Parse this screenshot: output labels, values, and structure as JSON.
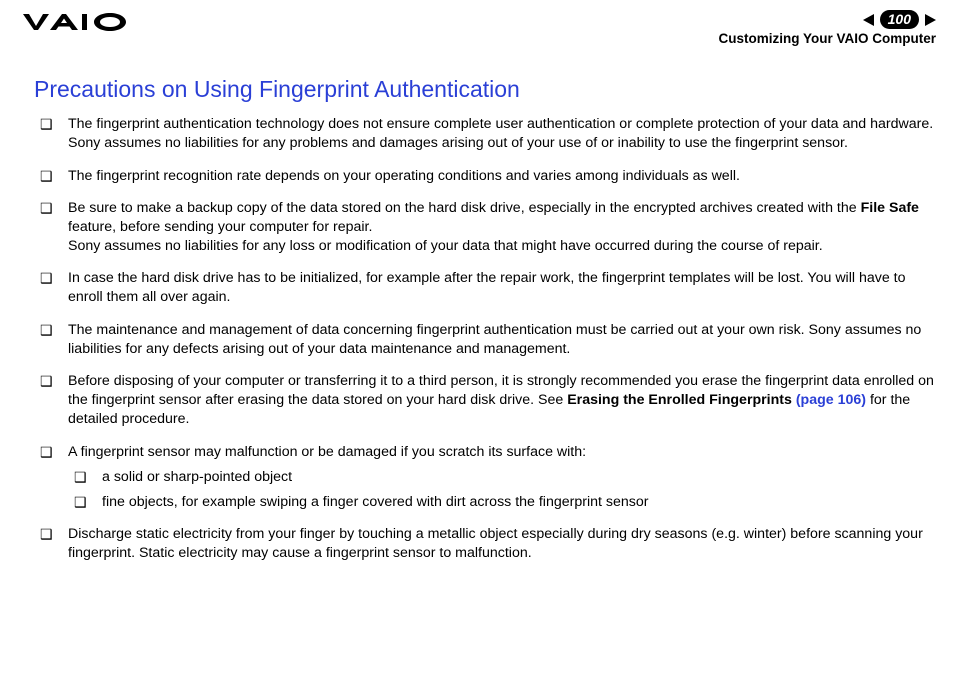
{
  "header": {
    "page_number": "100",
    "section": "Customizing Your VAIO Computer"
  },
  "title": "Precautions on Using Fingerprint Authentication",
  "items": [
    {
      "p1": "The fingerprint authentication technology does not ensure complete user authentication or complete protection of your data and hardware.",
      "p2": "Sony assumes no liabilities for any problems and damages arising out of your use of or inability to use the fingerprint sensor."
    },
    {
      "p1": "The fingerprint recognition rate depends on your operating conditions and varies among individuals as well."
    },
    {
      "p1a": "Be sure to make a backup copy of the data stored on the hard disk drive, especially in the encrypted archives created with the ",
      "bold1": "File Safe",
      "p1b": " feature, before sending your computer for repair.",
      "p2": "Sony assumes no liabilities for any loss or modification of your data that might have occurred during the course of repair."
    },
    {
      "p1": "In case the hard disk drive has to be initialized, for example after the repair work, the fingerprint templates will be lost. You will have to enroll them all over again."
    },
    {
      "p1": "The maintenance and management of data concerning fingerprint authentication must be carried out at your own risk. Sony assumes no liabilities for any defects arising out of your data maintenance and management."
    },
    {
      "p1a": "Before disposing of your computer or transferring it to a third person, it is strongly recommended you erase the fingerprint data enrolled on the fingerprint sensor after erasing the data stored on your hard disk drive. See ",
      "bold1": "Erasing the Enrolled Fingerprints ",
      "link_text": "(page 106)",
      "p1b": " for the detailed procedure."
    },
    {
      "p1": "A fingerprint sensor may malfunction or be damaged if you scratch its surface with:",
      "sub": [
        "a solid or sharp-pointed object",
        "fine objects, for example swiping a finger covered with dirt across the fingerprint sensor"
      ]
    },
    {
      "p1": "Discharge static electricity from your finger by touching a metallic object especially during dry seasons (e.g. winter) before scanning your fingerprint. Static electricity may cause a fingerprint sensor to malfunction."
    }
  ]
}
